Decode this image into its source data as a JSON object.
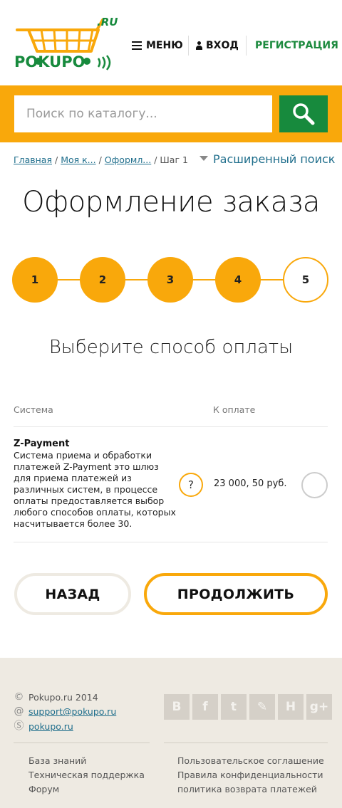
{
  "header": {
    "logo_text": "POKUPO",
    "logo_domain": ".RU",
    "menu_label": "МЕНЮ",
    "login_label": "ВХОД",
    "register_label": "РЕГИСТРАЦИЯ"
  },
  "search": {
    "placeholder": "Поиск по каталогу..."
  },
  "breadcrumb": {
    "items": [
      "Главная",
      "Моя к...",
      "Оформл...",
      "Шаг 1"
    ],
    "separator": "/"
  },
  "advanced_search_label": "Расширенный поиск",
  "page_title": "Оформление заказа",
  "steps": [
    "1",
    "2",
    "3",
    "4",
    "5"
  ],
  "active_step": "5",
  "subtitle": "Выберите способ оплаты",
  "table": {
    "col_system": "Система",
    "col_amount": "К оплате",
    "rows": [
      {
        "name": "Z-Payment",
        "description": "Система приема и обработки платежей Z-Payment это шлюз для приема платежей из различных систем, в процессе оплаты предоставляется выбор любого способов оплаты, которых насчитывается более 30.",
        "help": "?",
        "amount": "23 000, 50 руб."
      }
    ]
  },
  "buttons": {
    "back": "НАЗАД",
    "continue": "ПРОДОЛЖИТЬ"
  },
  "footer": {
    "copyright": "Pokupo.ru 2014",
    "email": "support@pokupo.ru",
    "skype": "pokupo.ru",
    "socials": [
      "В",
      "f",
      "t",
      "✎",
      "Н",
      "g+"
    ],
    "links_left": [
      "База знаний",
      "Техническая поддержка",
      "Форум"
    ],
    "links_right": [
      "Пользовательское соглашение",
      "Правила конфиденциальности",
      "политика возврата платежей"
    ]
  },
  "colors": {
    "accent": "#f9a80b",
    "brand_green": "#178a3d",
    "link": "#1f6e8c",
    "footer_bg": "#eeeae2"
  }
}
